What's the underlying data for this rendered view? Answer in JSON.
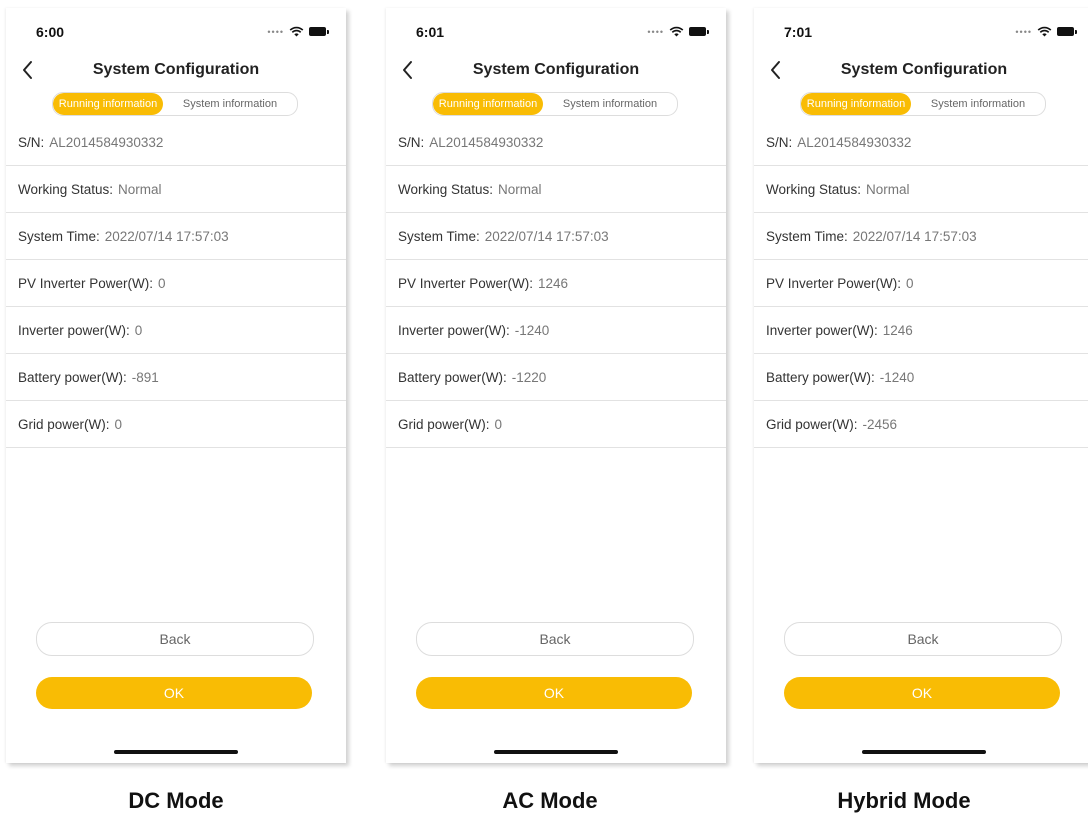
{
  "title": "System Configuration",
  "tabs": {
    "running": "Running information",
    "system": "System information"
  },
  "buttons": {
    "back": "Back",
    "ok": "OK"
  },
  "accent_color": "#f9bc04",
  "icons": [
    "back-chevron-icon",
    "wifi-icon",
    "battery-icon"
  ],
  "phones": [
    {
      "time": "6:00",
      "rows": [
        {
          "label": "S/N:",
          "value": "AL2014584930332"
        },
        {
          "label": "Working Status:",
          "value": "Normal"
        },
        {
          "label": "System Time:",
          "value": "2022/07/14 17:57:03"
        },
        {
          "label": "PV Inverter Power(W):",
          "value": "0"
        },
        {
          "label": "Inverter power(W):",
          "value": "0"
        },
        {
          "label": "Battery power(W):",
          "value": "-891"
        },
        {
          "label": "Grid power(W):",
          "value": "0"
        }
      ]
    },
    {
      "time": "6:01",
      "rows": [
        {
          "label": "S/N:",
          "value": "AL2014584930332"
        },
        {
          "label": "Working Status:",
          "value": "Normal"
        },
        {
          "label": "System Time:",
          "value": "2022/07/14 17:57:03"
        },
        {
          "label": "PV Inverter Power(W):",
          "value": "1246"
        },
        {
          "label": "Inverter power(W):",
          "value": "-1240"
        },
        {
          "label": "Battery power(W):",
          "value": "-1220"
        },
        {
          "label": "Grid power(W):",
          "value": "0"
        }
      ]
    },
    {
      "time": "7:01",
      "rows": [
        {
          "label": "S/N:",
          "value": "AL2014584930332"
        },
        {
          "label": "Working Status:",
          "value": "Normal"
        },
        {
          "label": "System Time:",
          "value": "2022/07/14 17:57:03"
        },
        {
          "label": "PV Inverter Power(W):",
          "value": "0"
        },
        {
          "label": "Inverter power(W):",
          "value": "1246"
        },
        {
          "label": "Battery power(W):",
          "value": "-1240"
        },
        {
          "label": "Grid power(W):",
          "value": "-2456"
        }
      ]
    }
  ],
  "captions": [
    "DC Mode",
    "AC Mode",
    "Hybrid Mode"
  ]
}
